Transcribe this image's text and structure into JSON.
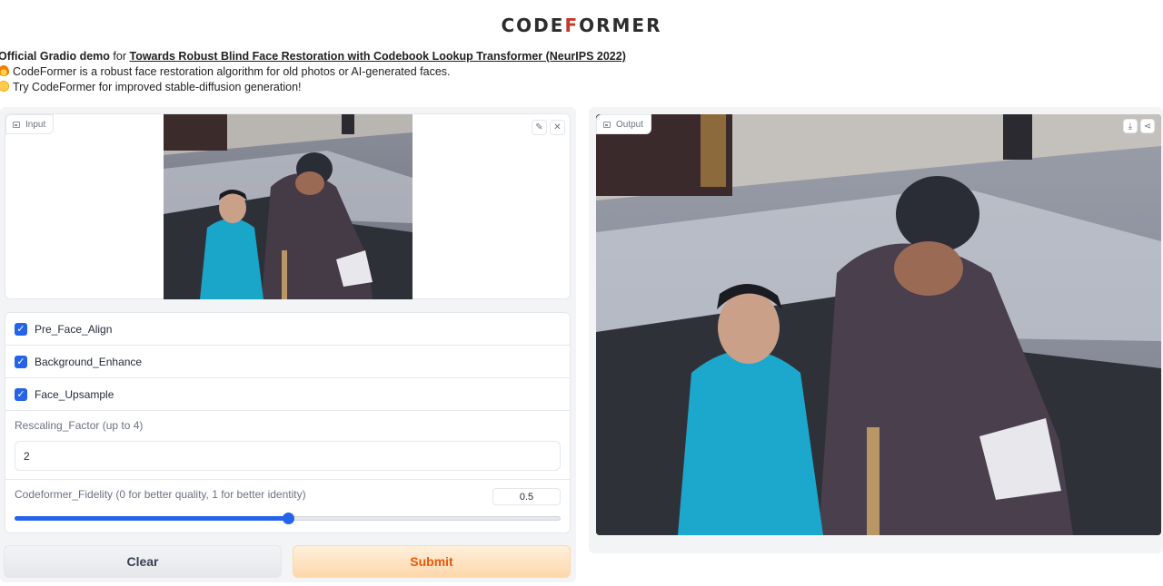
{
  "header": {
    "title_main": "CODE",
    "title_accent": "F",
    "title_rest": "ORMER"
  },
  "description": {
    "line1_bold": "Official Gradio demo",
    "line1_mid": " for ",
    "line1_link": "Towards Robust Blind Face Restoration with Codebook Lookup Transformer (NeurIPS 2022)",
    "line2": "CodeFormer is a robust face restoration algorithm for old photos or AI-generated faces.",
    "line3": "Try CodeFormer for improved stable-diffusion generation!"
  },
  "input_panel": {
    "label": "Input",
    "icon": "image-icon",
    "edit_icon": "pencil-icon",
    "close_icon": "close-icon"
  },
  "options": {
    "checkboxes": [
      {
        "label": "Pre_Face_Align",
        "checked": true
      },
      {
        "label": "Background_Enhance",
        "checked": true
      },
      {
        "label": "Face_Upsample",
        "checked": true
      }
    ],
    "rescaling": {
      "label": "Rescaling_Factor (up to 4)",
      "value": "2"
    },
    "fidelity": {
      "label": "Codeformer_Fidelity (0 for better quality, 1 for better identity)",
      "value": "0.5",
      "min": 0,
      "max": 1,
      "level": 0.5
    }
  },
  "buttons": {
    "clear": "Clear",
    "submit": "Submit"
  },
  "output_panel": {
    "label": "Output",
    "download_icon": "download-icon",
    "share_icon": "share-icon"
  },
  "colors": {
    "accent": "#2563eb",
    "submit_text": "#ea580c",
    "logo_red": "#c0392b"
  }
}
